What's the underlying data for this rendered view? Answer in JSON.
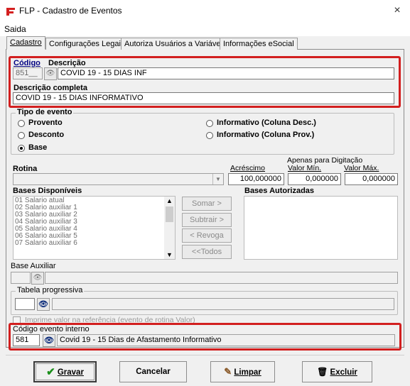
{
  "window": {
    "title": "FLP - Cadastro de Eventos",
    "close": "×"
  },
  "menu": {
    "saida": "Saida"
  },
  "tabs": [
    {
      "label": "Cadastro",
      "active": true
    },
    {
      "label": "Configurações Legais",
      "active": false
    },
    {
      "label": "Autoriza Usuários a Variáveis",
      "active": false
    },
    {
      "label": "Informações eSocial",
      "active": false
    }
  ],
  "codigo": {
    "label": "Código",
    "value": "851__"
  },
  "descricao": {
    "label": "Descrição",
    "value": "COVID 19 - 15 DIAS INF"
  },
  "descricao_completa": {
    "label": "Descrição completa",
    "value": "COVID 19 - 15 DIAS INFORMATIVO"
  },
  "tipo_evento": {
    "label": "Tipo de evento",
    "options": [
      "Provento",
      "Desconto",
      "Base",
      "Informativo (Coluna Desc.)",
      "Informativo (Coluna Prov.)"
    ],
    "selected": "Base"
  },
  "rotina": {
    "label": "Rotina",
    "value": ""
  },
  "acrescimo": {
    "label": "Acréscimo",
    "value": "100,000000"
  },
  "apenas_digitacao": "Apenas para Digitação",
  "valor_min": {
    "label": "Valor Mín.",
    "value": "0,000000"
  },
  "valor_max": {
    "label": "Valor Máx.",
    "value": "0,000000"
  },
  "bases_disponiveis": {
    "label": "Bases Disponíveis",
    "items": [
      "01 Salario atual",
      "02 Salario auxiliar 1",
      "03 Salario auxiliar 2",
      "04 Salario auxiliar 3",
      "05 Salario auxiliar 4",
      "06 Salario auxiliar 5",
      "07 Salario auxiliar 6"
    ]
  },
  "bases_autorizadas": {
    "label": "Bases Autorizadas"
  },
  "side_buttons": {
    "somar": "Somar >",
    "subtrair": "Subtrair >",
    "revoga": "< Revoga",
    "todos": "<<Todos"
  },
  "base_auxiliar": {
    "label": "Base Auxiliar",
    "value": ""
  },
  "tabela_progressiva": {
    "label": "Tabela progressiva",
    "value": ""
  },
  "imprime_valor": {
    "label": "Imprime valor na referência (evento de rotina Valor)",
    "checked": false
  },
  "codigo_evento_interno": {
    "label": "Código evento interno",
    "code": "581",
    "description": "Covid 19 - 15 Dias de Afastamento Informativo"
  },
  "footer": {
    "gravar": "Gravar",
    "cancelar": "Cancelar",
    "limpar": "Limpar",
    "excluir": "Excluir"
  },
  "colors": {
    "highlight": "#d21f1f",
    "title_bold": "#000080",
    "check_green": "#1a8f1a"
  }
}
